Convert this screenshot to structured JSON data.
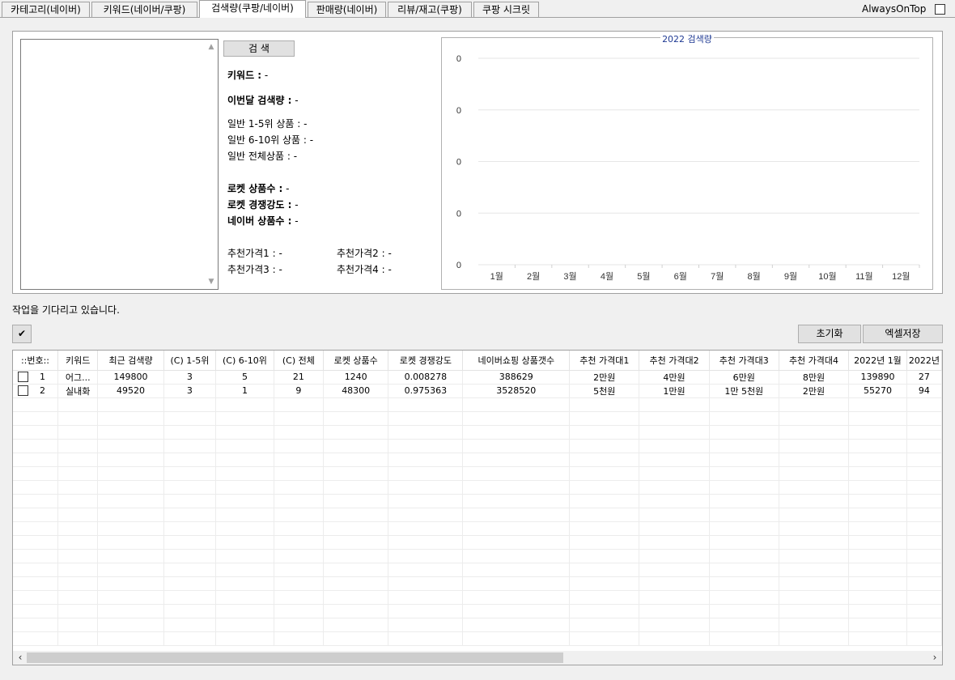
{
  "tabs": [
    {
      "label": "카테고리(네이버)"
    },
    {
      "label": "키워드(네이버/쿠팡)"
    },
    {
      "label": "검색량(쿠팡/네이버)"
    },
    {
      "label": "판매량(네이버)"
    },
    {
      "label": "리뷰/재고(쿠팡)"
    },
    {
      "label": "쿠팡 시크릿"
    }
  ],
  "always_on_top_label": "AlwaysOnTop",
  "search_button": "검 색",
  "info": {
    "keyword_label": "키워드 :",
    "keyword_value": " -",
    "month_search_label": "이번달 검색량 :",
    "month_search_value": " -",
    "normal_1_5": "일반 1-5위 상품 : -",
    "normal_6_10": "일반 6-10위 상품 : -",
    "normal_all": "일반 전체상품 : -",
    "rocket_count_label": "로켓 상품수 :",
    "rocket_count_value": " -",
    "rocket_comp_label": "로켓 경쟁강도 :",
    "rocket_comp_value": " -",
    "naver_count_label": "네이버 상품수 :",
    "naver_count_value": " -",
    "price1": "추천가격1 : -",
    "price2": "추천가격2 : -",
    "price3": "추천가격3 : -",
    "price4": "추천가격4 : -"
  },
  "chart_data": {
    "type": "line",
    "title": "2022 검색량",
    "categories": [
      "1월",
      "2월",
      "3월",
      "4월",
      "5월",
      "6월",
      "7월",
      "8월",
      "9월",
      "10월",
      "11월",
      "12월"
    ],
    "y_tick_labels": [
      "0",
      "0",
      "0",
      "0",
      "0"
    ],
    "series": [],
    "grid": true
  },
  "status_text": "작업을 기다리고 있습니다.",
  "check_all_icon": "checkmark-icon",
  "buttons": {
    "reset": "초기화",
    "excel": "엑셀저장"
  },
  "table": {
    "columns": [
      "::번호::",
      "키워드",
      "최근 검색량",
      "(C) 1-5위",
      "(C) 6-10위",
      "(C) 전체",
      "로켓 상품수",
      "로켓 경쟁강도",
      "네이버쇼핑 상품갯수",
      "추천 가격대1",
      "추천 가격대2",
      "추천 가격대3",
      "추천 가격대4",
      "2022년 1월",
      "2022년"
    ],
    "rows": [
      [
        "1",
        "어그...",
        "149800",
        "3",
        "5",
        "21",
        "1240",
        "0.008278",
        "388629",
        "2만원",
        "4만원",
        "6만원",
        "8만원",
        "139890",
        "27"
      ],
      [
        "2",
        "실내화",
        "49520",
        "3",
        "1",
        "9",
        "48300",
        "0.975363",
        "3528520",
        "5천원",
        "1만원",
        "1만 5천원",
        "2만원",
        "55270",
        "94"
      ]
    ]
  }
}
